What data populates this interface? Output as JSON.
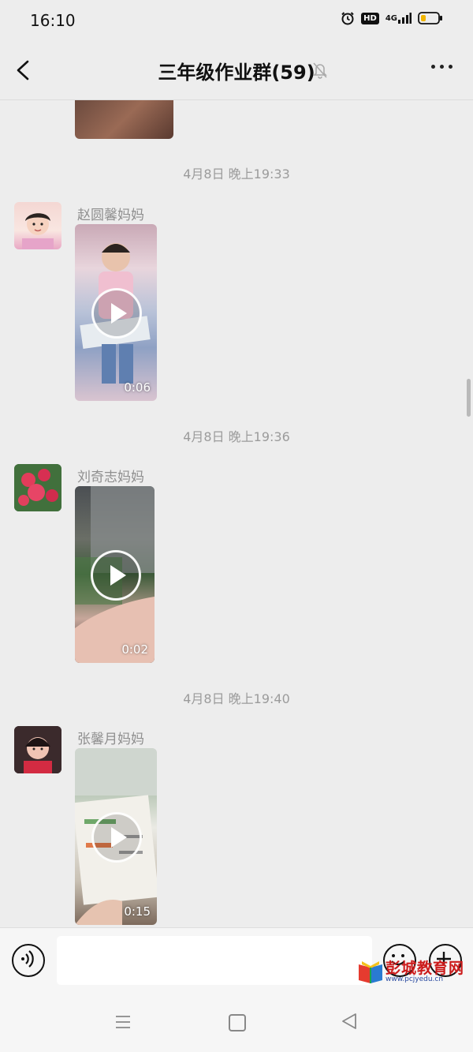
{
  "status_bar": {
    "time": "16:10",
    "icons": [
      "alarm-icon",
      "hd-icon",
      "signal-4g-icon",
      "battery-icon"
    ],
    "hd_label": "HD",
    "network_label": "4G"
  },
  "header": {
    "title": "三年级作业群(59)",
    "icons": [
      "back-arrow-icon",
      "mute-bell-icon",
      "more-icon"
    ]
  },
  "messages": [
    {
      "timestamp": "4月8日 晚上19:33",
      "sender": "赵圆馨妈妈",
      "duration": "0:06"
    },
    {
      "timestamp": "4月8日 晚上19:36",
      "sender": "刘奇志妈妈",
      "duration": "0:02"
    },
    {
      "timestamp": "4月8日 晚上19:40",
      "sender": "张馨月妈妈",
      "duration": "0:15"
    }
  ],
  "input_bar": {
    "icons": [
      "voice-icon",
      "emoji-icon",
      "plus-icon"
    ]
  },
  "watermark": {
    "title": "彭城教育网",
    "url": "www.pcjyedu.cn"
  },
  "system_nav": {
    "icons": [
      "menu-icon",
      "home-icon",
      "back-triangle-icon"
    ]
  },
  "colors": {
    "background": "#ededed",
    "timestamp": "#9b9b9b",
    "sender": "#8f8f8f",
    "watermark_red": "#cc1b1b"
  }
}
